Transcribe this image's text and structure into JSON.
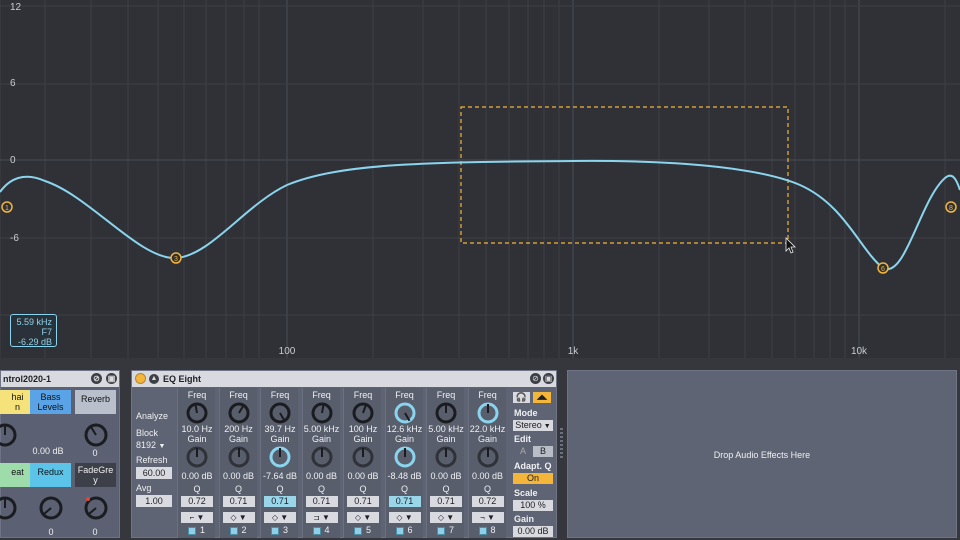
{
  "graph": {
    "gain_labels": [
      "12",
      "6",
      "0",
      "-6"
    ],
    "freq_labels": [
      "100",
      "1k",
      "10k"
    ],
    "readout": {
      "freq": "5.59 kHz",
      "band": "F7",
      "gain": "-6.29 dB"
    },
    "colors": {
      "curve": "#8ad4ee",
      "node": "#f3b53a",
      "selection": "#f3b53a"
    }
  },
  "rack": {
    "title": "ntrol2020-1",
    "pads": [
      {
        "label": "hai\nn",
        "color": "#f6e27a"
      },
      {
        "label": "Bass\nLevels",
        "color": "#5aa3e6"
      },
      {
        "label": "Reverb",
        "color": "#b9c0cc"
      },
      {
        "label": "eat",
        "color": "#9fdcab"
      },
      {
        "label": "Redux",
        "color": "#5cc4e9"
      },
      {
        "label": "FadeGre\ny",
        "color": "#3d4049"
      }
    ],
    "values": [
      "0.00 dB",
      "0",
      "0",
      "0",
      "0"
    ]
  },
  "eq": {
    "title": "EQ Eight",
    "side": {
      "analyze": "Analyze",
      "block_label": "Block",
      "block_value": "8192",
      "refresh_label": "Refresh",
      "refresh_value": "60.00",
      "avg_label": "Avg",
      "avg_value": "1.00"
    },
    "freq_label": "Freq",
    "gain_label": "Gain",
    "q_label": "Q",
    "bands": [
      {
        "freq": "10.0 Hz",
        "gain": "0.00 dB",
        "q": "0.72",
        "num": "1",
        "shape": "lowcut"
      },
      {
        "freq": "200 Hz",
        "gain": "0.00 dB",
        "q": "0.71",
        "num": "2",
        "shape": "bell"
      },
      {
        "freq": "39.7 Hz",
        "gain": "-7.64 dB",
        "q": "0.71",
        "num": "3",
        "shape": "bell"
      },
      {
        "freq": "5.00 kHz",
        "gain": "0.00 dB",
        "q": "0.71",
        "num": "4",
        "shape": "lowshelf"
      },
      {
        "freq": "100 Hz",
        "gain": "0.00 dB",
        "q": "0.71",
        "num": "5",
        "shape": "bell"
      },
      {
        "freq": "12.6 kHz",
        "gain": "-8.48 dB",
        "q": "0.71",
        "num": "6",
        "shape": "bell"
      },
      {
        "freq": "5.00 kHz",
        "gain": "0.00 dB",
        "q": "0.71",
        "num": "7",
        "shape": "bell"
      },
      {
        "freq": "22.0 kHz",
        "gain": "0.00 dB",
        "q": "0.72",
        "num": "8",
        "shape": "highcut"
      }
    ],
    "right": {
      "mode_label": "Mode",
      "mode_value": "Stereo",
      "edit_label": "Edit",
      "edit_a": "A",
      "edit_b": "B",
      "adapt_label": "Adapt. Q",
      "adapt_value": "On",
      "scale_label": "Scale",
      "scale_value": "100 %",
      "gain_label": "Gain",
      "gain_value": "0.00 dB"
    }
  },
  "drop_zone": {
    "label": "Drop Audio Effects Here"
  }
}
